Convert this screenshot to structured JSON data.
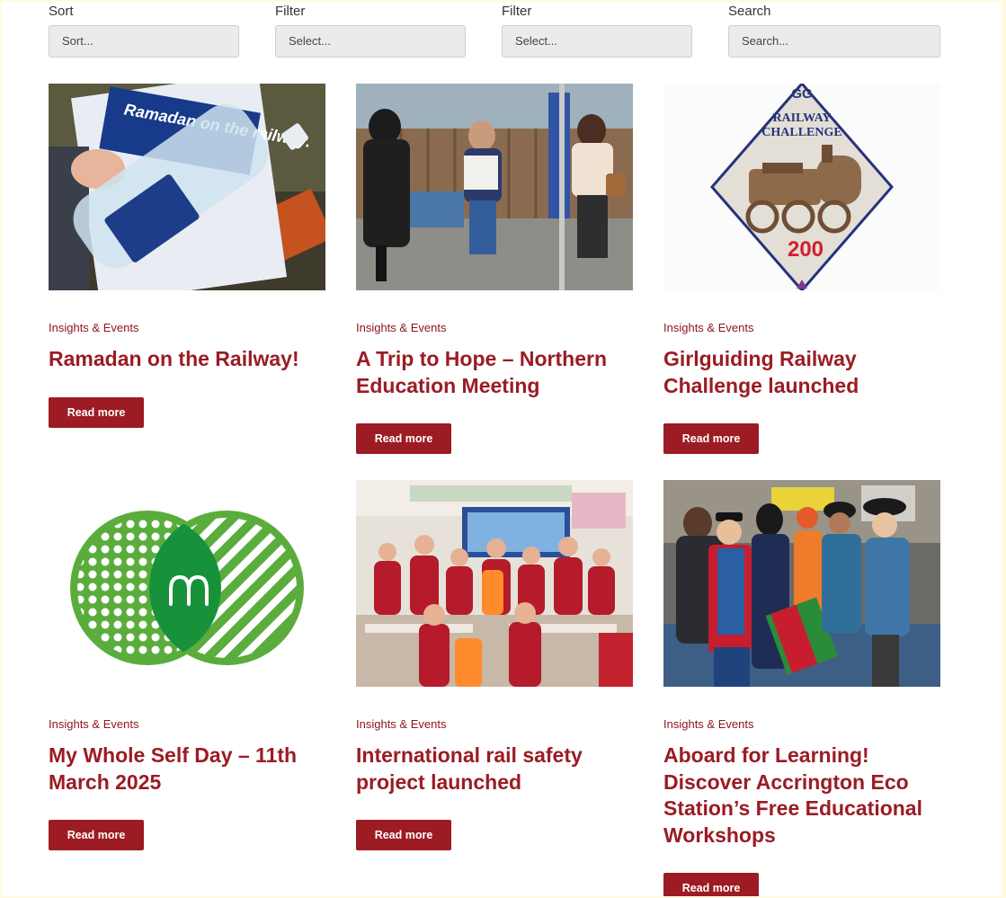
{
  "controls": {
    "sort": {
      "label": "Sort",
      "placeholder": "Sort..."
    },
    "filter1": {
      "label": "Filter",
      "placeholder": "Select..."
    },
    "filter2": {
      "label": "Filter",
      "placeholder": "Select..."
    },
    "search": {
      "label": "Search",
      "placeholder": "Search..."
    }
  },
  "posts": [
    {
      "category": "Insights & Events",
      "title": "Ramadan on the Railway!",
      "button": "Read more",
      "image_badge": "Ramadan on the railway."
    },
    {
      "category": "Insights & Events",
      "title": "A Trip to Hope – Northern Education Meeting",
      "button": "Read more"
    },
    {
      "category": "Insights & Events",
      "title": "Girlguiding Railway Challenge launched",
      "button": "Read more",
      "badge_line1": "RAILWAY",
      "badge_line2": "CHALLENGE",
      "badge_num": "200"
    },
    {
      "category": "Insights & Events",
      "title": "My Whole Self Day – 11th March 2025",
      "button": "Read more"
    },
    {
      "category": "Insights & Events",
      "title": "International rail safety project launched",
      "button": "Read more"
    },
    {
      "category": "Insights & Events",
      "title": "Aboard for Learning! Discover Accrington Eco Station’s Free Educational Workshops",
      "button": "Read more"
    }
  ],
  "colors": {
    "brand": "#9d1b22",
    "page_bg": "#fffbe0"
  }
}
